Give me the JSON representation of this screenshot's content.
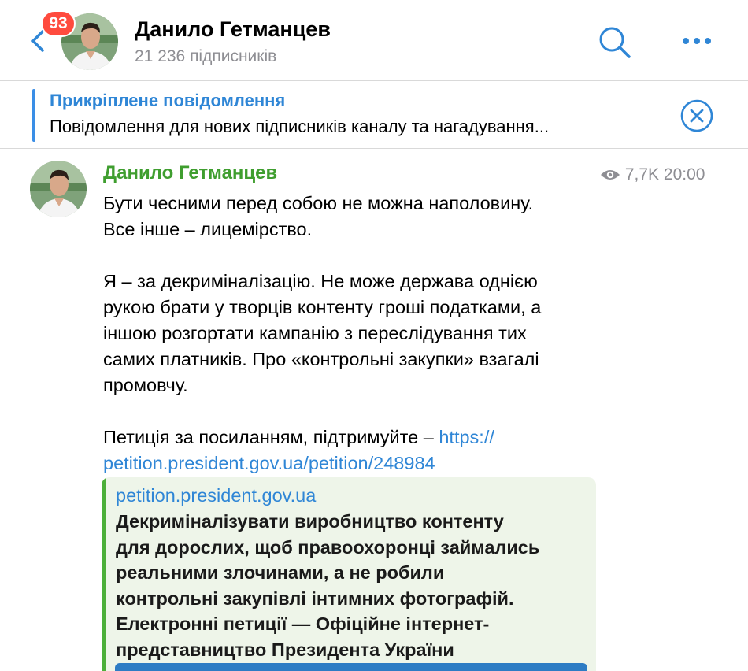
{
  "header": {
    "title": "Данило Гетманцев",
    "subscribers": "21 236 підписників",
    "unread_badge": "93"
  },
  "pinned": {
    "title": "Прикріплене повідомлення",
    "text": "Повідомлення для нових підписників каналу та нагадування..."
  },
  "post": {
    "author": "Данило Гетманцев",
    "views": "7,7K",
    "time": "20:00",
    "text_main": "Бути чесними перед собою не можна наполовину.\nВсе інше – лицемірство.\n\nЯ – за декриміналізацію. Не може держава однією\nрукою брати у творців контенту гроші податками, а\nіншою розгортати кампанію з переслідування тих\nсамих платників. Про «контрольні закупки» взагалі\nпромовчу.\n\nПетиція за посиланням, підтримуйте – ",
    "link_part1": "https://",
    "link_part2": "petition.president.gov.ua/petition/248984"
  },
  "link_preview": {
    "site": "petition.president.gov.ua",
    "text": "Декриміналізувати виробництво контенту\nдля дорослих, щоб правоохоронці займались\nреальними злочинами, а не робили\nконтрольні закупівлі інтимних фотографій.\nЕлектронні петиції — Офіційне інтернет-\nпредставництво Президента України"
  },
  "icons": {
    "back": "chevron-left-icon",
    "search": "search-icon",
    "more": "more-icon",
    "close": "close-circle-icon",
    "views": "eye-icon"
  },
  "colors": {
    "accent": "#2f86d6",
    "author_green": "#3f9e2f",
    "badge_red": "#ff4b3e",
    "preview_bg": "#eef5e9",
    "preview_bar": "#4caf3a"
  }
}
